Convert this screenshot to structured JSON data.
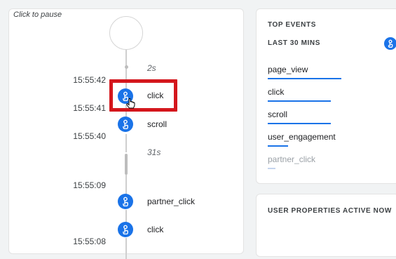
{
  "stream": {
    "pause_hint": "Click to pause",
    "gaps": [
      {
        "label": "2s"
      },
      {
        "label": "31s"
      }
    ],
    "times": [
      "15:55:42",
      "15:55:41",
      "15:55:40",
      "15:55:09",
      "15:55:08"
    ],
    "events": [
      {
        "label": "click",
        "icon": "user-touch-icon",
        "highlighted": true
      },
      {
        "label": "scroll",
        "icon": "user-touch-icon"
      },
      {
        "label": "partner_click",
        "icon": "user-touch-icon"
      },
      {
        "label": "click",
        "icon": "user-touch-icon"
      }
    ],
    "highlight_color": "#d4161c"
  },
  "top_events": {
    "title": "TOP EVENTS",
    "subtitle": "LAST 30 MINS",
    "items": [
      {
        "label": "page_view",
        "share": 1.0
      },
      {
        "label": "click",
        "share": 0.86
      },
      {
        "label": "scroll",
        "share": 0.86
      },
      {
        "label": "user_engagement",
        "share": 0.28
      },
      {
        "label": "partner_click",
        "share": 0.1
      }
    ]
  },
  "user_properties": {
    "title": "USER PROPERTIES ACTIVE NOW"
  },
  "colors": {
    "accent": "#1a73e8",
    "background": "#f1f3f4"
  }
}
